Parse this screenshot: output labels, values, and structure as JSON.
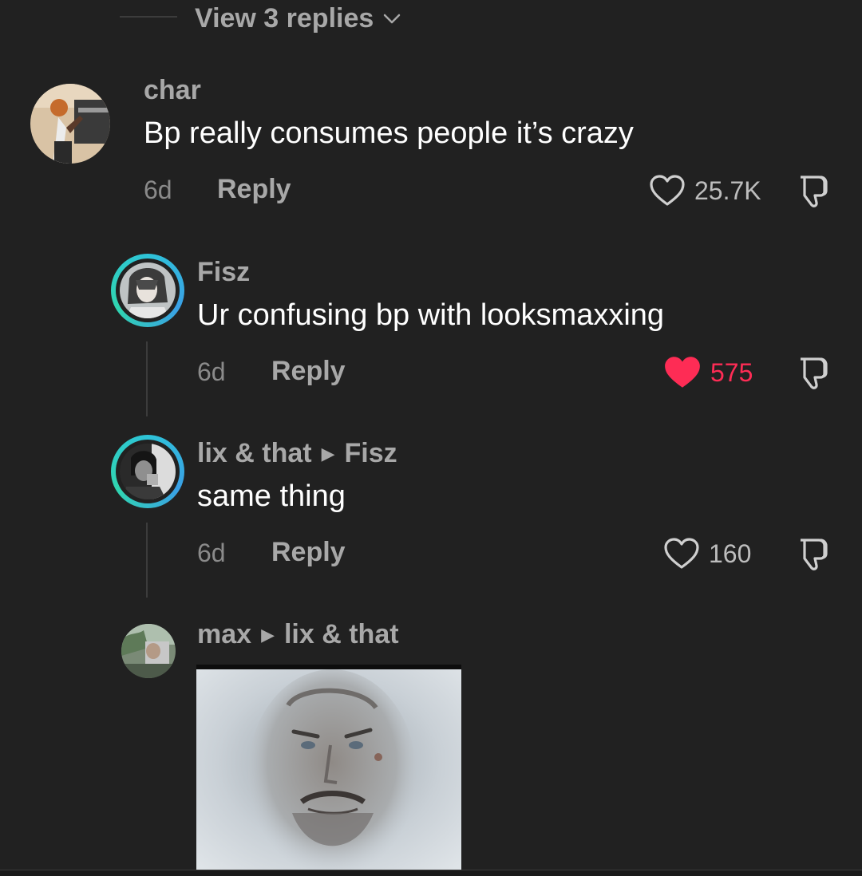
{
  "thread": {
    "view_replies_label": "View 3 replies"
  },
  "comments": [
    {
      "username": "char",
      "text": "Bp really consumes people it’s crazy",
      "time": "6d",
      "reply_label": "Reply",
      "likes": "25.7K",
      "liked": false
    },
    {
      "username": "Fisz",
      "text": "Ur confusing bp with looksmaxxing",
      "time": "6d",
      "reply_label": "Reply",
      "likes": "575",
      "liked": true
    },
    {
      "username": "lix & that",
      "reply_to": "Fisz",
      "text": "same thing",
      "time": "6d",
      "reply_label": "Reply",
      "likes": "160",
      "liked": false
    },
    {
      "username": "max",
      "reply_to": "lix & that"
    }
  ],
  "colors": {
    "background": "#212121",
    "liked_red": "#fe2c55",
    "story_ring": "#2ec4d8",
    "muted_text": "#a8a8a8"
  },
  "icons": {
    "like": "heart-outline-icon",
    "liked": "heart-filled-icon",
    "dislike": "thumbs-down-icon",
    "expand": "chevron-down-icon",
    "reply_arrow": "triangle-right-icon"
  }
}
